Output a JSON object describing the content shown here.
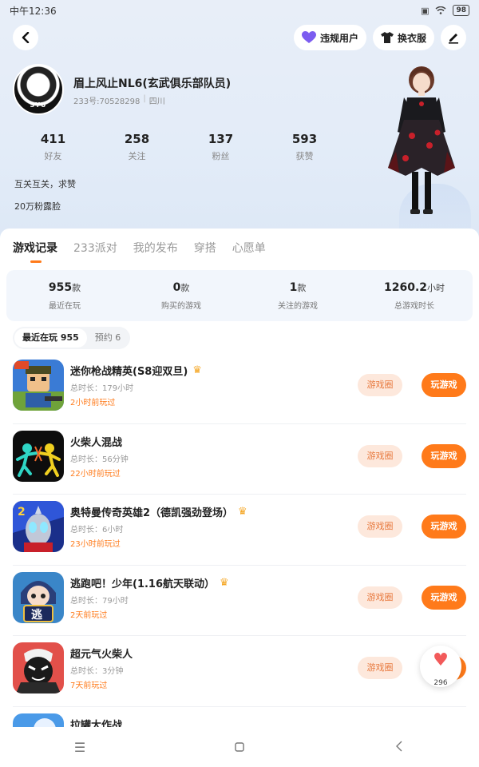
{
  "status_bar": {
    "time": "中午12:36",
    "battery": "98"
  },
  "header": {
    "report_label": "违规用户",
    "wardrobe_label": "换衣服"
  },
  "profile": {
    "name": "眉上风止NL6(玄武俱乐部队员)",
    "id_text": "233号:70528298",
    "location": "四川",
    "avatar_text": "SYU",
    "stats": [
      {
        "num": "411",
        "label": "好友"
      },
      {
        "num": "258",
        "label": "关注"
      },
      {
        "num": "137",
        "label": "粉丝"
      },
      {
        "num": "593",
        "label": "获赞"
      }
    ],
    "bio_line1": "互关互关，求赞",
    "bio_line2": "20万粉露脸"
  },
  "tabs": [
    "游戏记录",
    "233派对",
    "我的发布",
    "穿搭",
    "心愿单"
  ],
  "summary": [
    {
      "num": "955",
      "unit": "款",
      "label": "最近在玩"
    },
    {
      "num": "0",
      "unit": "款",
      "label": "购买的游戏"
    },
    {
      "num": "1",
      "unit": "款",
      "label": "关注的游戏"
    },
    {
      "num": "1260.2",
      "unit": "小时",
      "label": "总游戏时长"
    }
  ],
  "segments": {
    "recent": "最近在玩 955",
    "reserve": "预约 6"
  },
  "buttons": {
    "circle": "游戏圈",
    "play": "玩游戏"
  },
  "games": [
    {
      "title": "迷你枪战精英(S8迎双旦)",
      "duration": "总时长：179小时",
      "last": "2小时前玩过",
      "crown": true
    },
    {
      "title": "火柴人混战",
      "duration": "总时长：56分钟",
      "last": "22小时前玩过",
      "crown": false
    },
    {
      "title": "奥特曼传奇英雄2（德凯强劲登场）",
      "duration": "总时长：6小时",
      "last": "23小时前玩过",
      "crown": true
    },
    {
      "title": "逃跑吧！少年(1.16航天联动）",
      "duration": "总时长：79小时",
      "last": "2天前玩过",
      "crown": true
    },
    {
      "title": "超元气火柴人",
      "duration": "总时长：3分钟",
      "last": "7天前玩过",
      "crown": false
    },
    {
      "title": "拉罐大作战",
      "duration": "",
      "last": "",
      "crown": false
    }
  ],
  "like": {
    "count": "296"
  },
  "game_icon_text": {
    "tiaopao": "逃"
  },
  "colors": {
    "accent": "#ff7a1a",
    "circle_bg": "#fde8dc",
    "hero_bg": "#e3ecf8",
    "like": "#f25a5a"
  }
}
